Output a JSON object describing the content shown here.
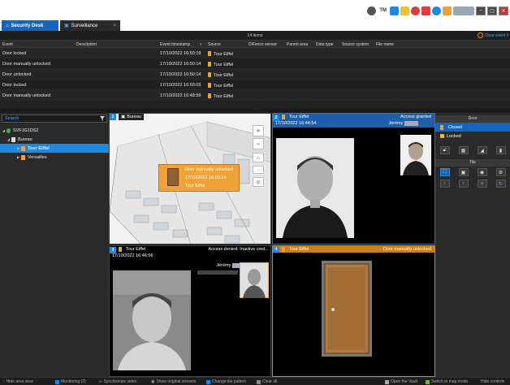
{
  "tabs": [
    {
      "label": "Security Desk"
    },
    {
      "label": "Surveillance"
    }
  ],
  "tray": {
    "user_text": "TM"
  },
  "events": {
    "count_label": "14 items",
    "clear_label": "Clear event li",
    "columns": [
      "Event",
      "Description",
      "Event timestamp",
      "Source",
      "DiFence sensor",
      "Parent area",
      "Data type",
      "Source system",
      "File name"
    ],
    "rows": [
      {
        "event": "Door locked",
        "timestamp": "17/10/2022 16:50:19",
        "source": "Tour Eiffel"
      },
      {
        "event": "Door manually unlocked",
        "timestamp": "17/10/2022 16:50:14",
        "source": "Tour Eiffel"
      },
      {
        "event": "Door unlocked",
        "timestamp": "17/10/2022 16:50:14",
        "source": "Tour Eiffel"
      },
      {
        "event": "Door locked",
        "timestamp": "17/10/2022 16:50:03",
        "source": "Tour Eiffel"
      },
      {
        "event": "Door manually unlocked",
        "timestamp": "17/10/2022 16:49:59",
        "source": "Tour Eiffel"
      }
    ]
  },
  "left": {
    "search_placeholder": "Search",
    "tree": [
      {
        "label": "SVFJG1DS2"
      },
      {
        "label": "Bureau"
      },
      {
        "label": "Tour Eiffel"
      },
      {
        "label": "Versailles"
      }
    ]
  },
  "tiles": {
    "t1": {
      "num": "1",
      "name": "Bureau",
      "popup_event": "Door manually unlocked",
      "popup_time": "17/10/2022 16:50:14",
      "popup_source": "Tour Eiffel"
    },
    "t2": {
      "num": "2",
      "name": "Tour Eiffel",
      "event": "Access granted",
      "timestamp": "17/10/2022 16:44:54",
      "person": "Jérémy"
    },
    "t3": {
      "num": "3",
      "name": "Tour Eiffel",
      "event": "Access denied: Inactive cred...",
      "timestamp": "17/10/2022 16:46:56",
      "person": "Jérémy"
    },
    "t4": {
      "num": "4",
      "name": "Tour Eiffel",
      "event": "Door manually unlocked"
    }
  },
  "right": {
    "door_header": "Door",
    "door_states": [
      {
        "label": "Closed"
      },
      {
        "label": "Locked"
      }
    ],
    "tile_header": "Tile"
  },
  "bottom": {
    "hide_area": "Hide area view",
    "monitoring": "Monitoring (2)",
    "sync_video": "Synchronize video",
    "show_streams": "Show original streams",
    "tile_pattern": "Change tile pattern",
    "clear_all": "Clear all",
    "open_vault": "Open the Vault",
    "map_mode": "Switch to map mode",
    "hide_controls": "Hide controls"
  }
}
